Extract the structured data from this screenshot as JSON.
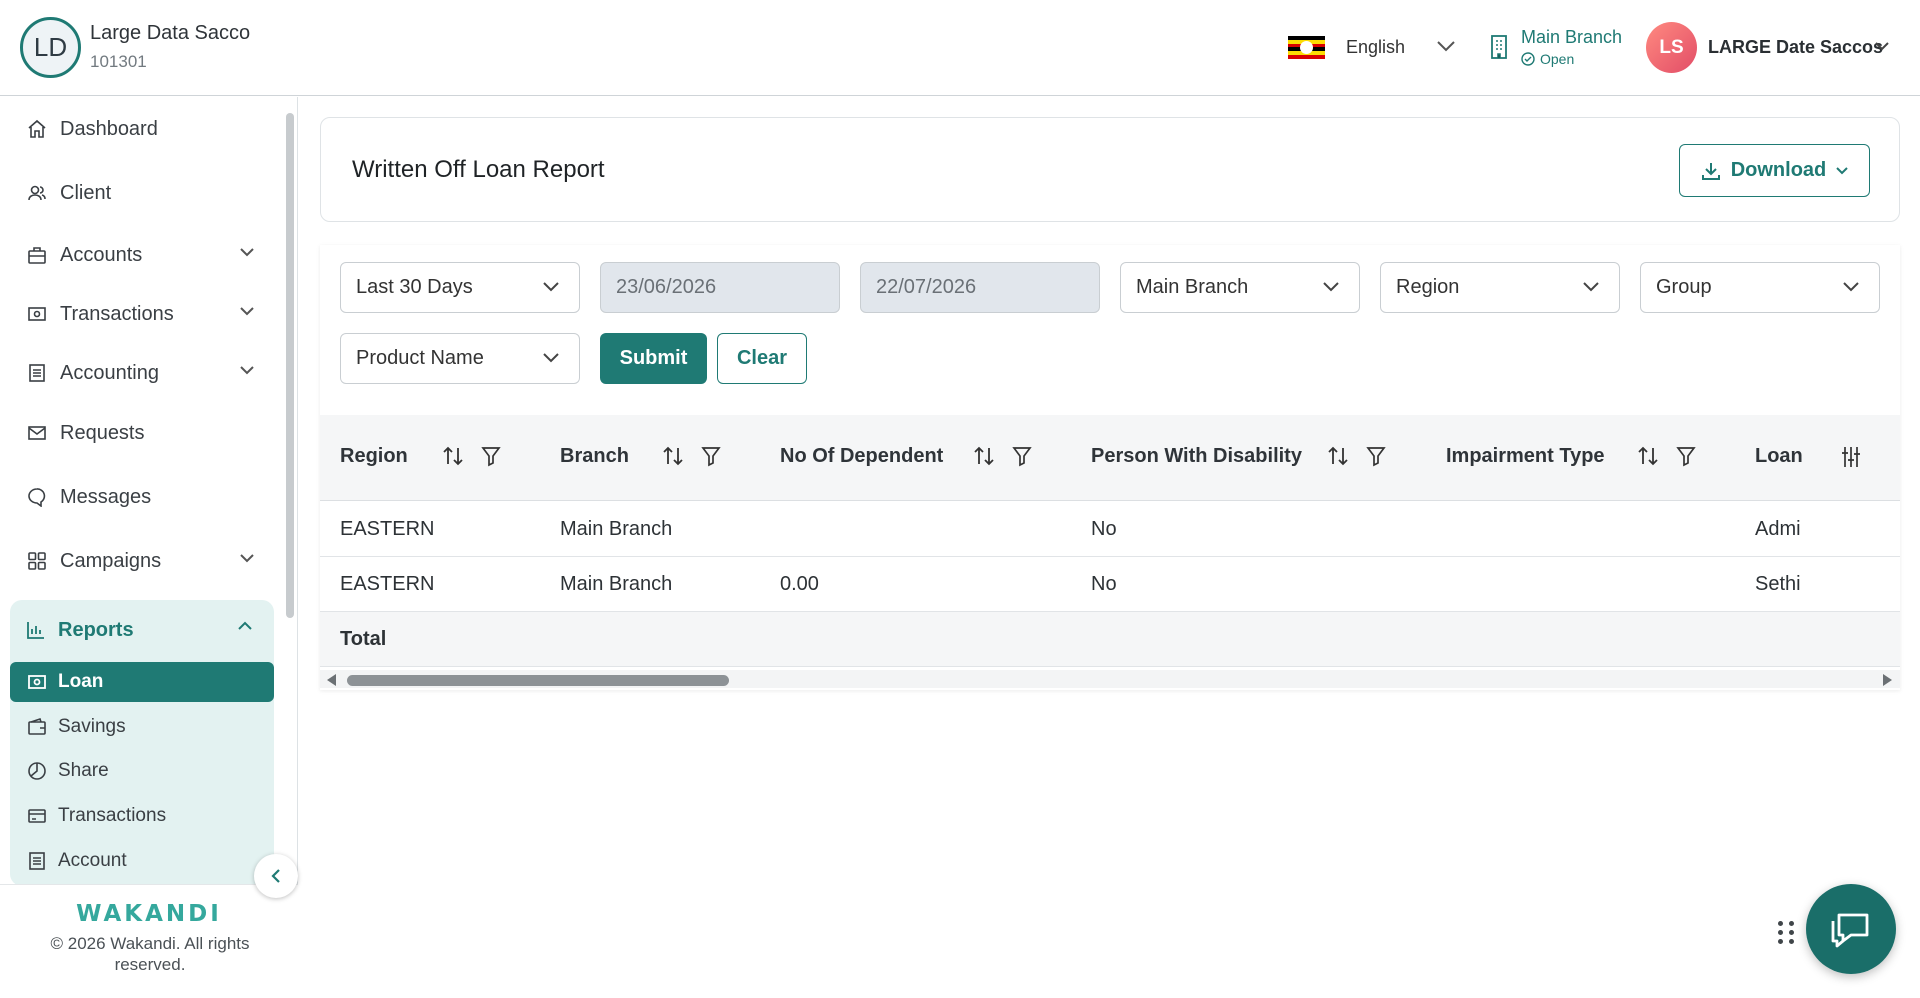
{
  "header": {
    "org_initials": "LD",
    "org_name": "Large Data Sacco",
    "org_code": "101301",
    "language": "English",
    "branch_name": "Main Branch",
    "branch_status": "Open",
    "user_initials": "LS",
    "user_name": "LARGE Date Saccos"
  },
  "sidebar": {
    "items": [
      {
        "label": "Dashboard",
        "icon": "home-icon"
      },
      {
        "label": "Client",
        "icon": "users-icon"
      },
      {
        "label": "Accounts",
        "icon": "briefcase-icon"
      },
      {
        "label": "Transactions",
        "icon": "cash-icon"
      },
      {
        "label": "Accounting",
        "icon": "ledger-icon"
      },
      {
        "label": "Requests",
        "icon": "mail-icon"
      },
      {
        "label": "Messages",
        "icon": "chat-icon"
      },
      {
        "label": "Campaigns",
        "icon": "grid-icon"
      }
    ],
    "reports": {
      "label": "Reports",
      "sub_items": [
        {
          "label": "Loan",
          "active": true
        },
        {
          "label": "Savings"
        },
        {
          "label": "Share"
        },
        {
          "label": "Transactions"
        },
        {
          "label": "Account"
        }
      ]
    },
    "footer": {
      "logo": "WAKANDI",
      "copyright": "© 2026 Wakandi. All rights reserved."
    }
  },
  "main": {
    "title": "Written Off Loan Report",
    "download_label": "Download",
    "filters": {
      "period": "Last 30 Days",
      "start_date": "23/06/2026",
      "end_date": "22/07/2026",
      "branch": "Main Branch",
      "region": "Region",
      "group": "Group",
      "product": "Product Name",
      "submit_label": "Submit",
      "clear_label": "Clear"
    },
    "table": {
      "columns": [
        "Region",
        "Branch",
        "No Of Dependent",
        "Person With Disability",
        "Impairment Type",
        "Loan"
      ],
      "rows": [
        [
          "EASTERN",
          "Main Branch",
          "",
          "No",
          "",
          "Admi"
        ],
        [
          "EASTERN",
          "Main Branch",
          "0.00",
          "No",
          "",
          "Sethi"
        ]
      ],
      "total_label": "Total"
    }
  },
  "colors": {
    "primary": "#1f7a74",
    "reports_panel": "#e3f2f1",
    "user_avatar": "#e24d67",
    "status_open": "#1f7a74"
  }
}
